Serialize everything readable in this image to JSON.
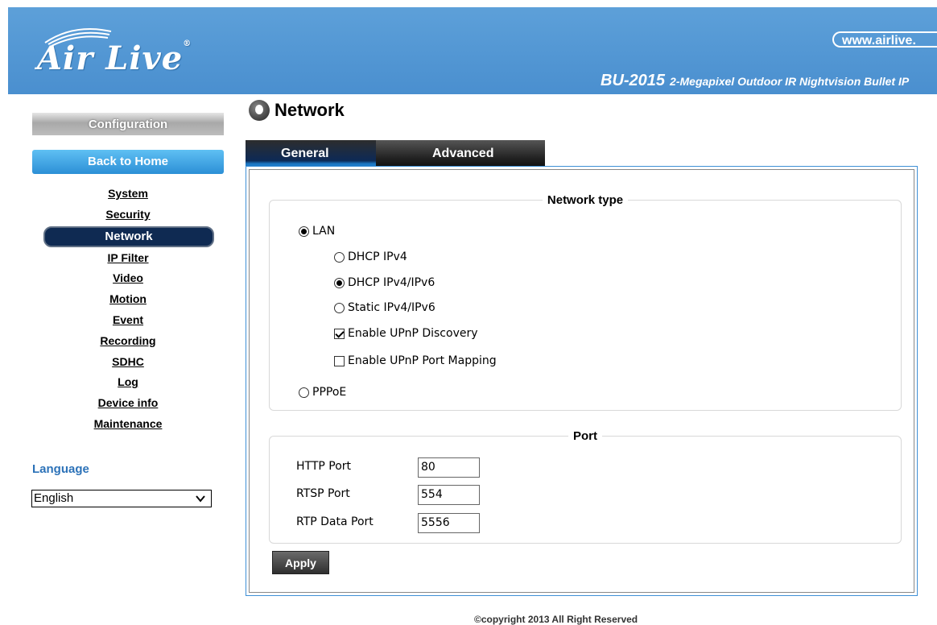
{
  "header": {
    "brand": "Air Live",
    "url": "www.airlive.",
    "model_number": "BU-2015",
    "model_desc": "2-Megapixel Outdoor IR Nightvision Bullet IP"
  },
  "sidebar": {
    "configuration_label": "Configuration",
    "back_label": "Back to Home",
    "items": [
      {
        "label": "System"
      },
      {
        "label": "Security"
      },
      {
        "label": "Network"
      },
      {
        "label": "IP Filter"
      },
      {
        "label": "Video"
      },
      {
        "label": "Motion"
      },
      {
        "label": "Event"
      },
      {
        "label": "Recording"
      },
      {
        "label": "SDHC"
      },
      {
        "label": "Log"
      },
      {
        "label": "Device info"
      },
      {
        "label": "Maintenance"
      }
    ],
    "active_item": "Network",
    "language_title": "Language",
    "language_value": "English"
  },
  "main": {
    "title": "Network",
    "tabs": [
      {
        "label": "General",
        "active": true
      },
      {
        "label": "Advanced",
        "active": false
      }
    ],
    "network_type": {
      "legend": "Network type",
      "lan": {
        "label": "LAN",
        "checked": true
      },
      "dhcp_ipv4": {
        "label": "DHCP IPv4",
        "checked": false
      },
      "dhcp_ipv4_ipv6": {
        "label": "DHCP IPv4/IPv6",
        "checked": true
      },
      "static": {
        "label": "Static IPv4/IPv6",
        "checked": false
      },
      "upnp_discovery": {
        "label": "Enable UPnP Discovery",
        "checked": true
      },
      "upnp_port_mapping": {
        "label": "Enable UPnP Port Mapping",
        "checked": false
      },
      "pppoe": {
        "label": "PPPoE",
        "checked": false
      }
    },
    "port": {
      "legend": "Port",
      "http": {
        "label": "HTTP Port",
        "value": "80"
      },
      "rtsp": {
        "label": "RTSP Port",
        "value": "554"
      },
      "rtp": {
        "label": "RTP Data Port",
        "value": "5556"
      }
    },
    "apply_label": "Apply"
  },
  "footer": {
    "copyright": "©copyright 2013 All Right Reserved"
  },
  "colors": {
    "banner": "#4a8fcf",
    "accent": "#2c72b8",
    "active_menu": "#0f2a52",
    "panel_border": "#3f90d6"
  }
}
